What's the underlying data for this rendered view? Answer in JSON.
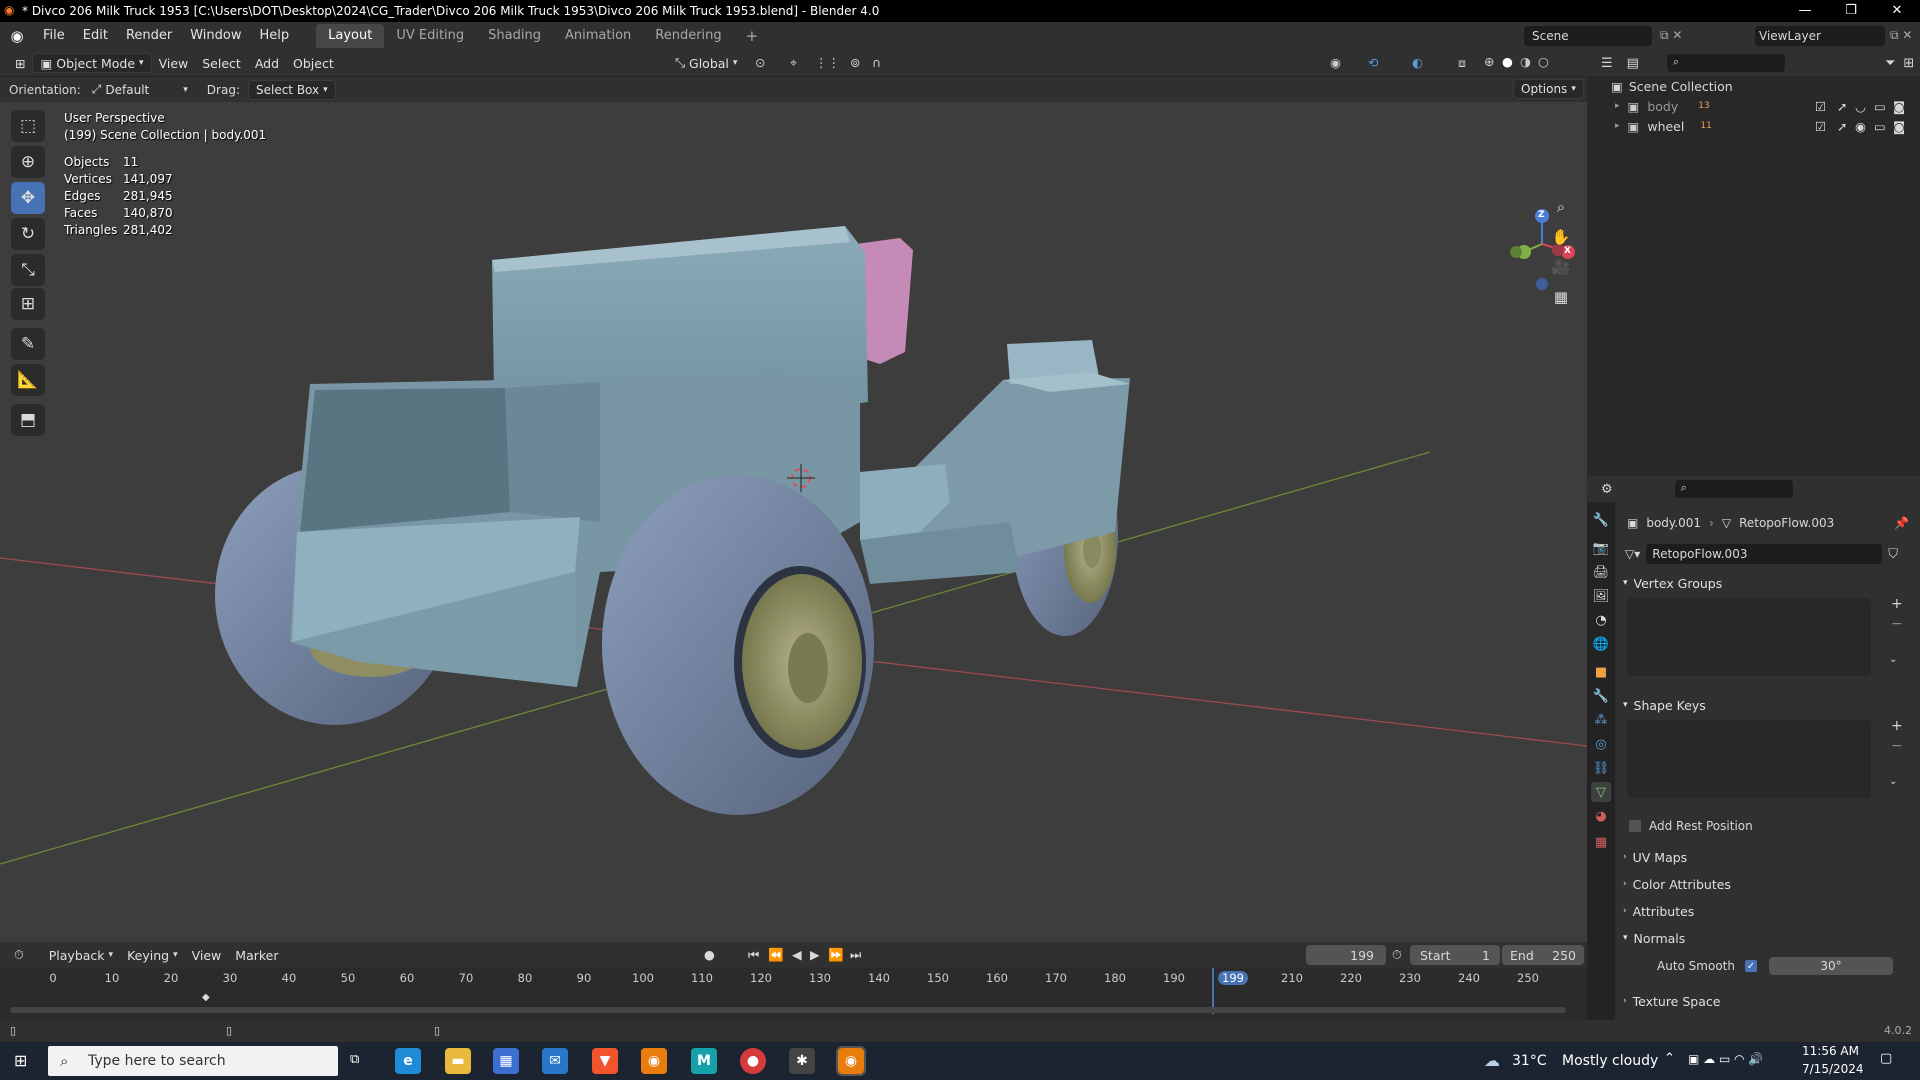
{
  "window": {
    "title": "* Divco 206 Milk Truck 1953 [C:\\Users\\DOT\\Desktop\\2024\\CG_Trader\\Divco 206 Milk Truck 1953\\Divco 206 Milk Truck 1953.blend] - Blender 4.0",
    "minimize": "—",
    "maximize": "❐",
    "close": "✕"
  },
  "menu": {
    "items": [
      "File",
      "Edit",
      "Render",
      "Window",
      "Help"
    ],
    "workspaces": [
      "Layout",
      "UV Editing",
      "Shading",
      "Animation",
      "Rendering"
    ],
    "add_workspace": "+",
    "scene_label": "Scene",
    "viewlayer_label": "ViewLayer"
  },
  "viewport_header": {
    "mode": "Object Mode",
    "view": "View",
    "select": "Select",
    "add": "Add",
    "object": "Object",
    "transform": "Global",
    "orientation_label": "Orientation:",
    "orientation_value": "Default",
    "drag_label": "Drag:",
    "drag_value": "Select Box",
    "options": "Options"
  },
  "overlay": {
    "perspective": "User Perspective",
    "collection": "(199) Scene Collection | body.001",
    "stats": [
      {
        "label": "Objects",
        "value": "11"
      },
      {
        "label": "Vertices",
        "value": "141,097"
      },
      {
        "label": "Edges",
        "value": "281,945"
      },
      {
        "label": "Faces",
        "value": "140,870"
      },
      {
        "label": "Triangles",
        "value": "281,402"
      }
    ],
    "gizmo": {
      "z": "Z",
      "x": "X",
      "y": "Y"
    }
  },
  "outliner": {
    "root": "Scene Collection",
    "items": [
      {
        "name": "body",
        "count": "13"
      },
      {
        "name": "wheel",
        "count": "11"
      }
    ]
  },
  "properties": {
    "object_name": "body.001",
    "data_name": "RetopoFlow.003",
    "mesh_field": "RetopoFlow.003",
    "panels": {
      "vertex_groups": "Vertex Groups",
      "shape_keys": "Shape Keys",
      "add_rest_position": "Add Rest Position",
      "uv_maps": "UV Maps",
      "color_attributes": "Color Attributes",
      "attributes": "Attributes",
      "normals": "Normals",
      "auto_smooth": "Auto Smooth",
      "auto_smooth_angle": "30°",
      "texture_space": "Texture Space"
    }
  },
  "timeline": {
    "playback": "Playback",
    "keying": "Keying",
    "view": "View",
    "marker": "Marker",
    "current_frame": "199",
    "start_label": "Start",
    "start_value": "1",
    "end_label": "End",
    "end_value": "250",
    "ticks": [
      "0",
      "10",
      "20",
      "30",
      "40",
      "50",
      "60",
      "70",
      "80",
      "90",
      "100",
      "110",
      "120",
      "130",
      "140",
      "150",
      "160",
      "170",
      "180",
      "190",
      "199",
      "210",
      "220",
      "230",
      "240",
      "250"
    ]
  },
  "status": {
    "version": "4.0.2"
  },
  "taskbar": {
    "search_placeholder": "Type here to search",
    "weather_temp": "31°C",
    "weather_desc": "Mostly cloudy",
    "time": "11:56 AM",
    "date": "7/15/2024"
  },
  "colors": {
    "accent": "#4772b3",
    "body_color": "#7d9eac",
    "wheel_rim": "#a3a270",
    "seat": "#c489b5",
    "axis_red": "#b5474f",
    "axis_green": "#6c8d2f"
  }
}
